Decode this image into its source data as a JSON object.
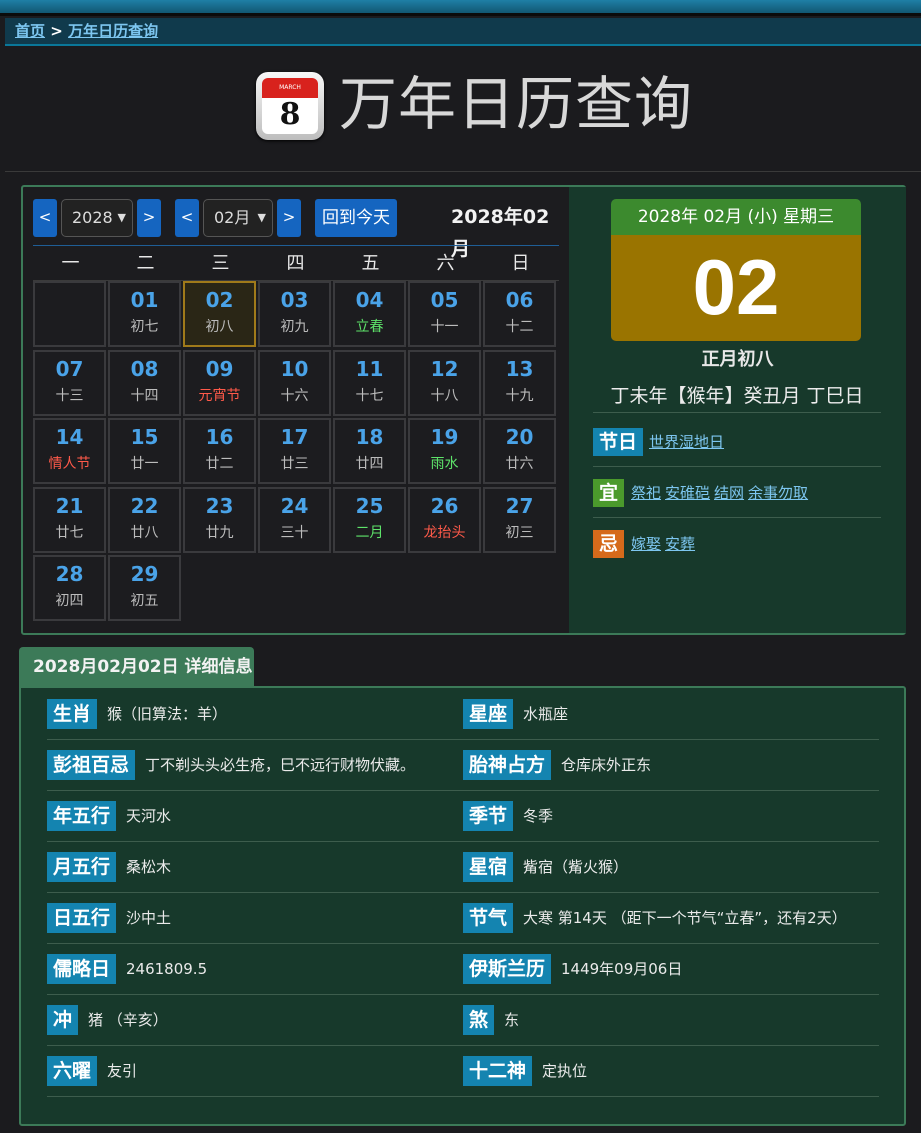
{
  "breadcrumb": {
    "home": "首页",
    "separator": ">",
    "current": "万年日历查询"
  },
  "header": {
    "title": "万年日历查询",
    "icon_name": "calendar-icon",
    "icon_month": "MARCH",
    "icon_day": "8"
  },
  "controls": {
    "prev_label": "<",
    "next_label": ">",
    "year_value": "2028",
    "month_value": "02月",
    "today_button": "回到今天",
    "current_ym": "2028年02月"
  },
  "weekdays": [
    "一",
    "二",
    "三",
    "四",
    "五",
    "六",
    "日"
  ],
  "days": [
    {
      "d": "01",
      "l": "初七",
      "t": ""
    },
    {
      "d": "02",
      "l": "初八",
      "t": "",
      "selected": true
    },
    {
      "d": "03",
      "l": "初九",
      "t": ""
    },
    {
      "d": "04",
      "l": "立春",
      "t": "green"
    },
    {
      "d": "05",
      "l": "十一",
      "t": ""
    },
    {
      "d": "06",
      "l": "十二",
      "t": ""
    },
    {
      "d": "07",
      "l": "十三",
      "t": ""
    },
    {
      "d": "08",
      "l": "十四",
      "t": ""
    },
    {
      "d": "09",
      "l": "元宵节",
      "t": "red"
    },
    {
      "d": "10",
      "l": "十六",
      "t": ""
    },
    {
      "d": "11",
      "l": "十七",
      "t": ""
    },
    {
      "d": "12",
      "l": "十八",
      "t": ""
    },
    {
      "d": "13",
      "l": "十九",
      "t": ""
    },
    {
      "d": "14",
      "l": "情人节",
      "t": "red"
    },
    {
      "d": "15",
      "l": "廿一",
      "t": ""
    },
    {
      "d": "16",
      "l": "廿二",
      "t": ""
    },
    {
      "d": "17",
      "l": "廿三",
      "t": ""
    },
    {
      "d": "18",
      "l": "廿四",
      "t": ""
    },
    {
      "d": "19",
      "l": "雨水",
      "t": "green"
    },
    {
      "d": "20",
      "l": "廿六",
      "t": ""
    },
    {
      "d": "21",
      "l": "廿七",
      "t": ""
    },
    {
      "d": "22",
      "l": "廿八",
      "t": ""
    },
    {
      "d": "23",
      "l": "廿九",
      "t": ""
    },
    {
      "d": "24",
      "l": "三十",
      "t": ""
    },
    {
      "d": "25",
      "l": "二月",
      "t": "green"
    },
    {
      "d": "26",
      "l": "龙抬头",
      "t": "red"
    },
    {
      "d": "27",
      "l": "初三",
      "t": ""
    },
    {
      "d": "28",
      "l": "初四",
      "t": ""
    },
    {
      "d": "29",
      "l": "初五",
      "t": ""
    }
  ],
  "first_weekday_offset": 1,
  "day_card": {
    "header": "2028年 02月 (小) 星期三",
    "day": "02",
    "lunar": "正月初八",
    "ganzhi": "丁未年【猴年】癸丑月 丁巳日"
  },
  "info": {
    "festival_tag": "节日",
    "festival_links": [
      "世界湿地日"
    ],
    "yi_tag": "宜",
    "yi_links": [
      "祭祀",
      "安碓硙",
      "结网",
      "余事勿取"
    ],
    "ji_tag": "忌",
    "ji_links": [
      "嫁娶",
      "安葬"
    ]
  },
  "detail": {
    "tab_title": "2028月02月02日 详细信息",
    "left": [
      {
        "k": "生肖",
        "v": "猴（旧算法：羊）"
      },
      {
        "k": "彭祖百忌",
        "v": "丁不剃头头必生疮，巳不远行财物伏藏。"
      },
      {
        "k": "年五行",
        "v": "天河水"
      },
      {
        "k": "月五行",
        "v": "桑松木"
      },
      {
        "k": "日五行",
        "v": "沙中土"
      },
      {
        "k": "儒略日",
        "v": "2461809.5"
      },
      {
        "k": "冲",
        "v": "猪 （辛亥）"
      },
      {
        "k": "六曜",
        "v": "友引"
      }
    ],
    "right": [
      {
        "k": "星座",
        "v": "水瓶座"
      },
      {
        "k": "胎神占方",
        "v": "仓库床外正东"
      },
      {
        "k": "季节",
        "v": "冬季"
      },
      {
        "k": "星宿",
        "v": "觜宿（觜火猴）"
      },
      {
        "k": "节气",
        "v": "大寒 第14天 （距下一个节气“立春”，还有2天）"
      },
      {
        "k": "伊斯兰历",
        "v": "1449年09月06日"
      },
      {
        "k": "煞",
        "v": "东"
      },
      {
        "k": "十二神",
        "v": "定执位"
      }
    ]
  },
  "colors": {
    "accent": "#1565c0",
    "panel_border": "#3c7a58",
    "date_header": "#3c8a2e",
    "date_body": "#9a7400"
  }
}
